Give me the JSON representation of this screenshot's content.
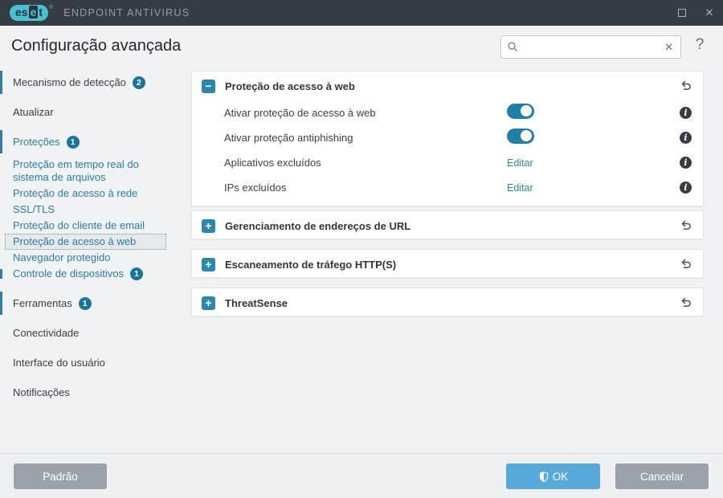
{
  "colors": {
    "titlebar_bg": "#353c44",
    "logo_cyan": "#49c1d3",
    "accent_blue": "#2a7ca4",
    "toggle_on": "#1f7fa5",
    "badge_bg": "#1b749c",
    "ok_button": "#56a9d8",
    "gray_button": "#9ba2aa",
    "card_bg": "#ffffff",
    "window_bg": "#f1f2f4"
  },
  "titlebar": {
    "brand_p1": "es",
    "brand_p2": "e",
    "brand_p3": "t",
    "brand_reg": "®",
    "product": "ENDPOINT ANTIVIRUS",
    "close_glyph": "✕"
  },
  "header": {
    "title": "Configuração avançada",
    "search_placeholder": "",
    "clear_glyph": "✕",
    "help_glyph": "?"
  },
  "sidebar": {
    "items": [
      {
        "label": "Mecanismo de detecção",
        "badge": "2"
      },
      {
        "label": "Atualizar"
      },
      {
        "label": "Proteções",
        "badge": "1"
      },
      {
        "label": "Proteção em tempo real do sistema de arquivos"
      },
      {
        "label": "Proteção de acesso à rede"
      },
      {
        "label": "SSL/TLS"
      },
      {
        "label": "Proteção do cliente de email"
      },
      {
        "label": "Proteção de acesso à web",
        "selected": true
      },
      {
        "label": "Navegador protegido"
      },
      {
        "label": "Controle de dispositivos",
        "badge": "1"
      },
      {
        "label": "Ferramentas",
        "badge": "1"
      },
      {
        "label": "Conectividade"
      },
      {
        "label": "Interface do usuário"
      },
      {
        "label": "Notificações"
      }
    ]
  },
  "main": {
    "info_glyph": "i",
    "sections": [
      {
        "title": "Proteção de acesso à web",
        "expanded": true,
        "expander_glyph": "−",
        "rows": [
          {
            "label": "Ativar proteção de acesso à web",
            "control": "toggle",
            "value": "on"
          },
          {
            "label": "Ativar proteção antiphishing",
            "control": "toggle",
            "value": "on"
          },
          {
            "label": "Aplicativos excluídos",
            "control": "link",
            "link_label": "Editar"
          },
          {
            "label": "IPs excluídos",
            "control": "link",
            "link_label": "Editar"
          }
        ]
      },
      {
        "title": "Gerenciamento de endereços de URL",
        "expanded": false,
        "expander_glyph": "+"
      },
      {
        "title": "Escaneamento de tráfego HTTP(S)",
        "expanded": false,
        "expander_glyph": "+"
      },
      {
        "title": "ThreatSense",
        "expanded": false,
        "expander_glyph": "+"
      }
    ]
  },
  "footer": {
    "default_label": "Padrão",
    "ok_label": "OK",
    "cancel_label": "Cancelar"
  }
}
